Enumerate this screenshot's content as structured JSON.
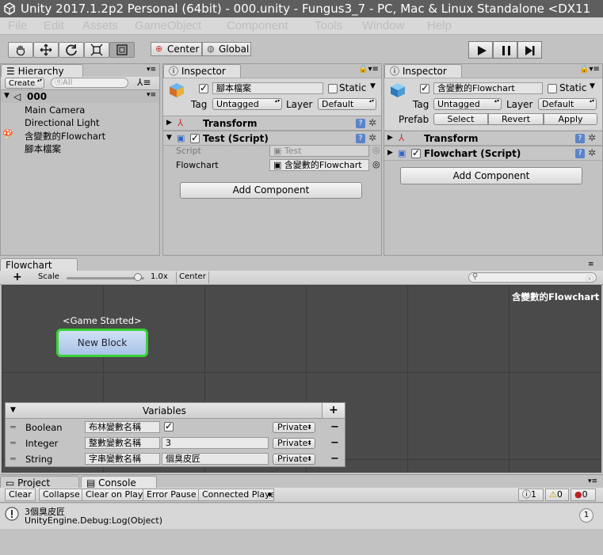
{
  "window": {
    "title": "Unity 2017.1.2p2 Personal (64bit) - 000.unity - Fungus3_7 - PC, Mac & Linux Standalone <DX11"
  },
  "menu": [
    "File",
    "Edit",
    "Assets",
    "GameObject",
    "Component",
    "Tools",
    "Window",
    "Help"
  ],
  "toolbar": {
    "pivot_center": "Center",
    "pivot_global": "Global"
  },
  "hierarchy": {
    "tab": "Hierarchy",
    "create": "Create",
    "search_placeholder": "ⓠAll",
    "scene": "000",
    "items": [
      "Main Camera",
      "Directional Light",
      "含變數的Flowchart",
      "腳本檔案"
    ]
  },
  "inspector1": {
    "tab": "Inspector",
    "object_name": "腳本檔案",
    "static_label": "Static",
    "tag_label": "Tag",
    "tag_value": "Untagged",
    "layer_label": "Layer",
    "layer_value": "Default",
    "transform": "Transform",
    "script_component": "Test (Script)",
    "script_label": "Script",
    "script_value": "Test",
    "flowchart_label": "Flowchart",
    "flowchart_value": "含變數的Flowchart",
    "add_component": "Add Component"
  },
  "inspector2": {
    "tab": "Inspector",
    "object_name": "含變數的Flowchart",
    "static_label": "Static",
    "tag_label": "Tag",
    "tag_value": "Untagged",
    "layer_label": "Layer",
    "layer_value": "Default",
    "prefab_label": "Prefab",
    "prefab_select": "Select",
    "prefab_revert": "Revert",
    "prefab_apply": "Apply",
    "transform": "Transform",
    "flowchart_component": "Flowchart (Script)",
    "add_component": "Add Component"
  },
  "flowchart": {
    "tab": "Flowchart",
    "add": "+",
    "scale_label": "Scale",
    "scale_value": "1.0x",
    "scale_fraction": 0.92,
    "center_button": "Center",
    "name": "含變數的Flowchart",
    "event_label": "<Game Started>",
    "block_label": "New Block"
  },
  "variables": {
    "title": "Variables",
    "add": "+",
    "rows": [
      {
        "type": "Boolean",
        "name": "布林變數名稱",
        "value": "",
        "checked": true,
        "access": "Private"
      },
      {
        "type": "Integer",
        "name": "整數變數名稱",
        "value": "3",
        "access": "Private"
      },
      {
        "type": "String",
        "name": "字串變數名稱",
        "value": "個臭皮匠",
        "access": "Private"
      }
    ]
  },
  "bottom_tabs": {
    "project": "Project",
    "console": "Console"
  },
  "console": {
    "buttons": [
      "Clear",
      "Collapse",
      "Clear on Play",
      "Error Pause",
      "Connected Playe"
    ],
    "info_count": "1",
    "warn_count": "0",
    "error_count": "0",
    "message_line1": "3個臭皮匠",
    "message_line2": "UnityEngine.Debug:Log(Object)",
    "message_count": "1"
  },
  "colors": {
    "titlebar": "#5e5e5e",
    "grid_bg": "#4a4a4a",
    "block_outline": "#39d339",
    "block_fill": "#b8cfee"
  }
}
